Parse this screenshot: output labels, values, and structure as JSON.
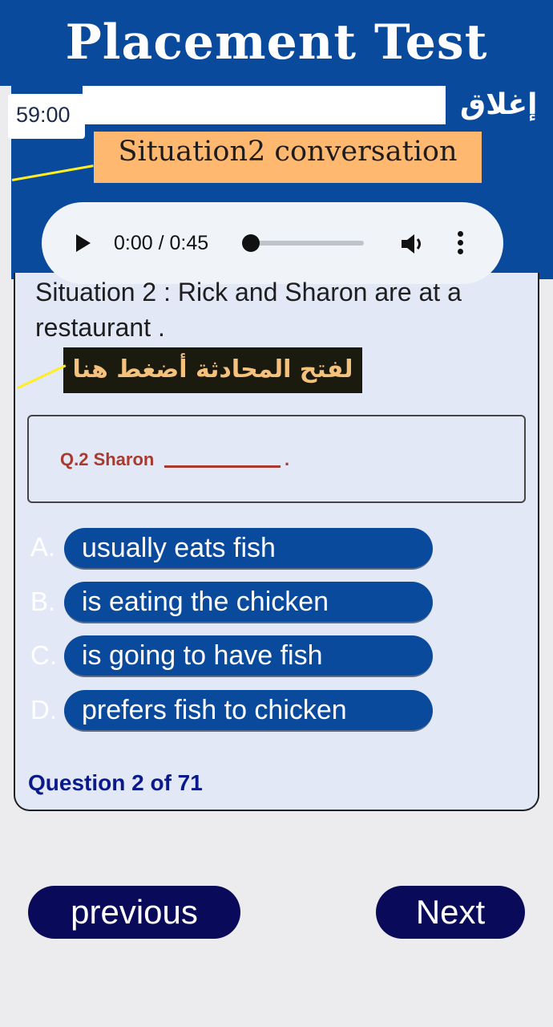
{
  "header": {
    "title": "Placement Test"
  },
  "timer": "59:00",
  "close_label": "إغلاق",
  "situation_label": "Situation2 conversation",
  "audio": {
    "time": "0:00 / 0:45",
    "progress": 0.03
  },
  "question": {
    "text": "Situation 2 : Rick and Sharon are at a restaurant .",
    "arabic_hint": "لفتح المحادثة أضغط هنا",
    "prompt": "Q.2 Sharon",
    "end": "."
  },
  "options": [
    {
      "letter": "A.",
      "label": "usually eats fish"
    },
    {
      "letter": "B.",
      "label": "is eating the chicken"
    },
    {
      "letter": "C.",
      "label": "is going to have fish"
    },
    {
      "letter": "D.",
      "label": "prefers fish to chicken"
    }
  ],
  "progress_text": "Question 2 of 71",
  "nav": {
    "previous": "previous",
    "next": "Next"
  },
  "colors": {
    "primary": "#0a4a9c",
    "accent": "#ffb870",
    "nav": "#0a0a5a",
    "question": "#a83a2e"
  }
}
